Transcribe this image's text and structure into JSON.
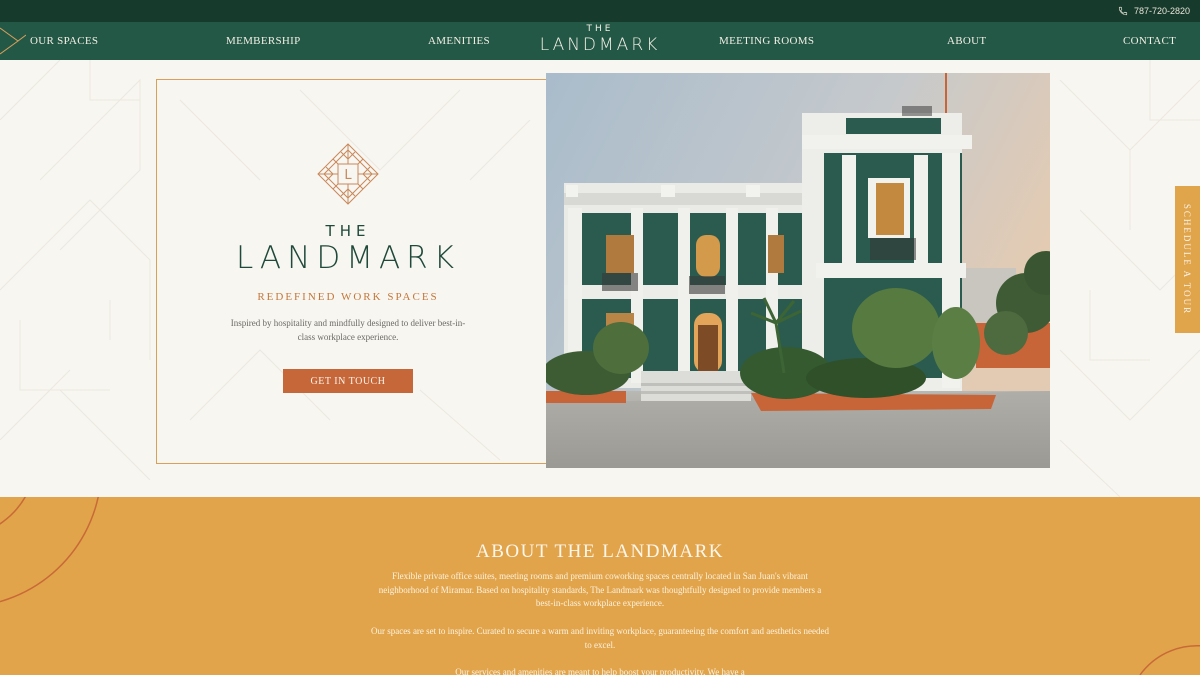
{
  "topbar": {
    "phone": "787-720-2820",
    "phone_icon": "phone-icon"
  },
  "nav": {
    "items": [
      "OUR SPACES",
      "MEMBERSHIP",
      "AMENITIES",
      "MEETING ROOMS",
      "ABOUT",
      "CONTACT"
    ],
    "logo_the": "THE",
    "logo_name": "LANDMARK"
  },
  "hero": {
    "emblem_letter": "L",
    "the": "THE",
    "name": "LANDMARK",
    "tagline": "REDEFINED WORK SPACES",
    "description": "Inspired by hospitality and mindfully designed to deliver best-in-class workplace experience.",
    "cta": "GET IN TOUCH"
  },
  "side_tab": {
    "label": "SCHEDULE A TOUR"
  },
  "about": {
    "title": "ABOUT THE LANDMARK",
    "p1": "Flexible private office suites, meeting rooms and premium coworking spaces centrally located in San Juan's vibrant neighborhood of Miramar. Based on hospitality standards, The Landmark was thoughtfully designed to provide members a best-in-class workplace experience.",
    "p2": "Our spaces are set to inspire. Curated to secure a warm and inviting workplace, guaranteeing the comfort and aesthetics needed to excel.",
    "p3": "Our services and amenities are meant to help boost your productivity. We have a"
  },
  "colors": {
    "topbar": "#163b2d",
    "nav": "#245846",
    "accent_orange": "#c6673a",
    "gold": "#e2a44b",
    "frame": "#d9a05b",
    "green_text": "#1f4a3b"
  }
}
